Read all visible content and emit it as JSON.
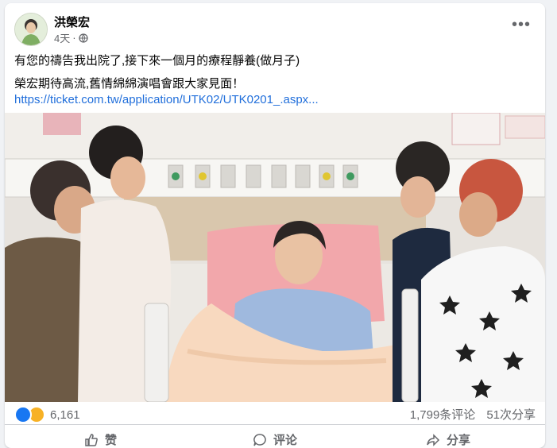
{
  "post": {
    "author": "洪榮宏",
    "time": "4天",
    "separator": "·",
    "text_line1": "有您的禱告我出院了,接下來一個月的療程靜養(做月子)",
    "text_line2": "榮宏期待高流,舊情綿綿演唱會跟大家見面！",
    "link": "https://ticket.com.tw/application/UTK02/UTK0201_.aspx...",
    "more_label": "•••"
  },
  "stats": {
    "reactions": "6,161",
    "comments": "1,799条评论",
    "shares": "51次分享"
  },
  "actions": {
    "like": "赞",
    "comment": "评论",
    "share": "分享"
  },
  "colors": {
    "link": "#216fdb",
    "like_blue": "#1877f2",
    "care_yellow": "#f7b125",
    "secondary_text": "#65676b"
  }
}
